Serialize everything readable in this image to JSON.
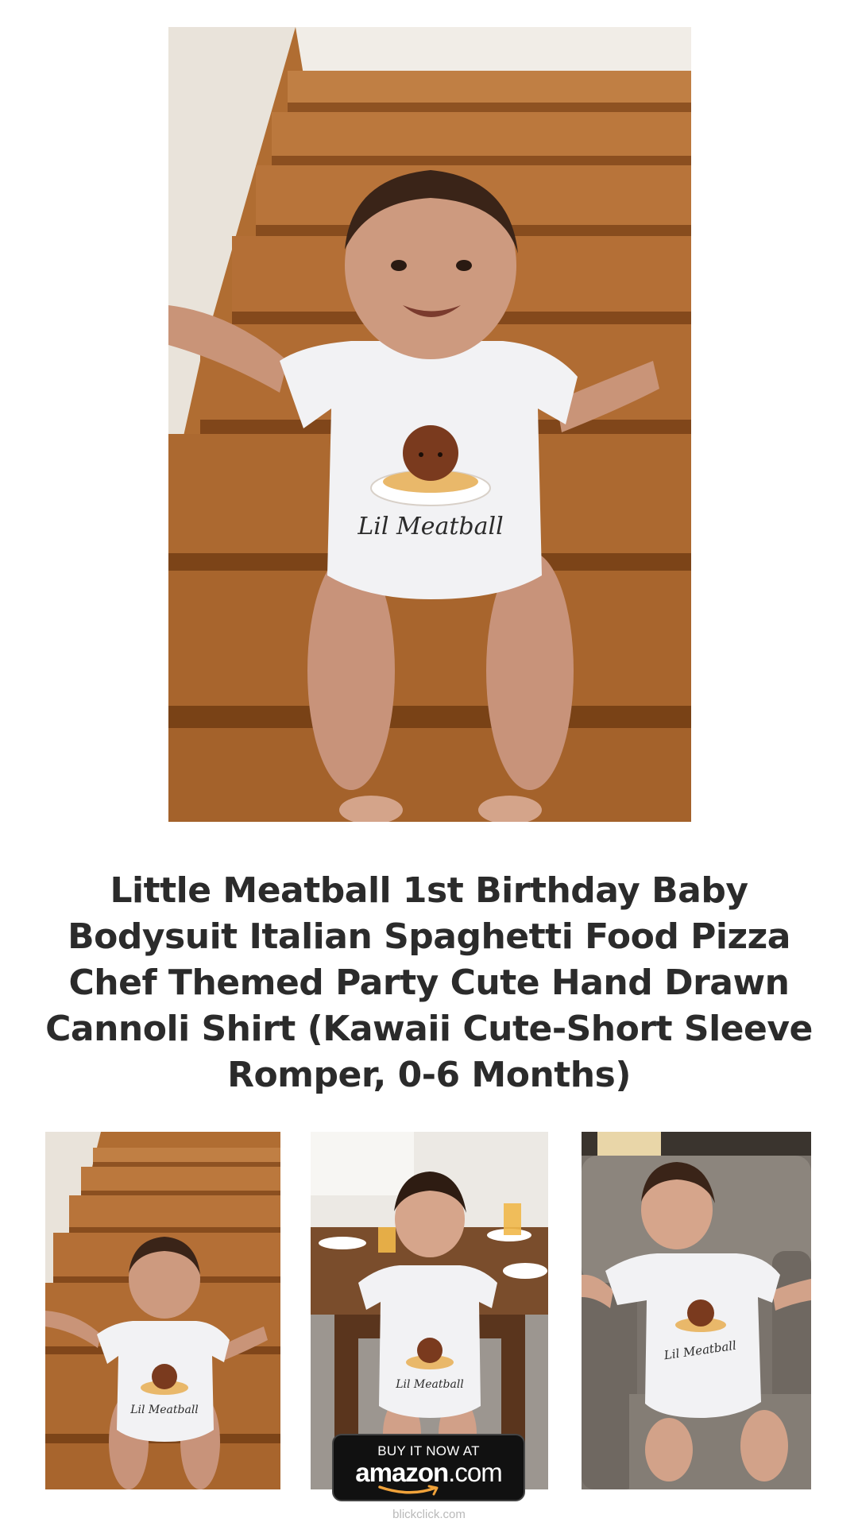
{
  "product": {
    "title": "Little Meatball 1st Birthday Baby Bodysuit Italian Spaghetti Food Pizza Chef Themed Party Cute Hand Drawn Cannoli Shirt (Kawaii Cute-Short Sleeve Romper, 0-6 Months)",
    "print_text": "Lil Meatball"
  },
  "cta": {
    "top_label": "BUY IT NOW AT",
    "brand": "amazon",
    "brand_suffix": ".com"
  },
  "footer": {
    "text": "blickclick.com"
  },
  "icons": {
    "hero": "product-photo",
    "thumb_1": "product-photo-stairs",
    "thumb_2": "product-photo-table",
    "thumb_3": "product-photo-sofa",
    "smile": "amazon-smile-arrow-icon"
  },
  "colors": {
    "title": "#2b2b2b",
    "button_bg": "#111111",
    "amazon_arrow": "#f0a23a",
    "footer": "#b9b9b9"
  }
}
